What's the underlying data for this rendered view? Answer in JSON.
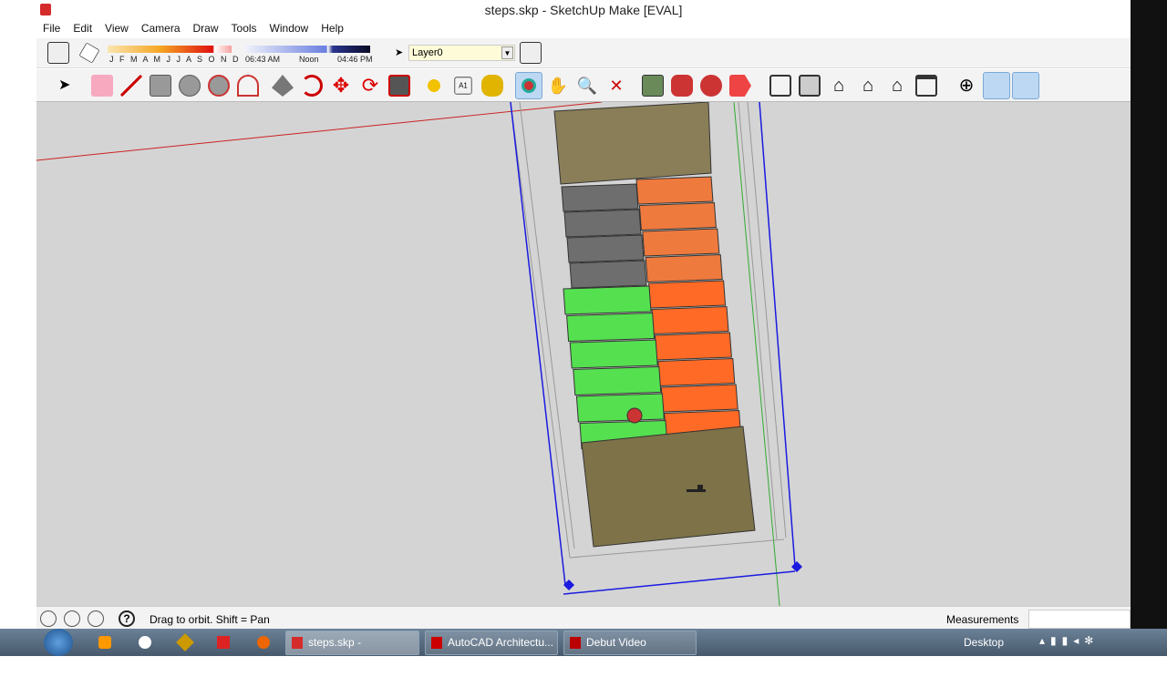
{
  "window": {
    "title": "steps.skp - SketchUp Make [EVAL]"
  },
  "menu": [
    "File",
    "Edit",
    "View",
    "Camera",
    "Draw",
    "Tools",
    "Window",
    "Help"
  ],
  "shadow": {
    "months": "J F M A M J J A S O N D",
    "time_start": "06:43 AM",
    "time_mid": "Noon",
    "time_end": "04:46 PM"
  },
  "layer": {
    "current": "Layer0"
  },
  "tools": [
    "select",
    "eraser",
    "pencil",
    "rectangle",
    "circle",
    "polygon",
    "arc",
    "push-pull",
    "follow-me",
    "move",
    "rotate",
    "scale",
    "tape-measure",
    "text",
    "paint-bucket",
    "orbit",
    "pan",
    "zoom",
    "zoom-extents",
    "section",
    "components",
    "styles",
    "get-models",
    "iso",
    "top",
    "front",
    "right",
    "back",
    "left",
    "position-camera",
    "walk",
    "look-around"
  ],
  "status": {
    "hint": "Drag to orbit.  Shift = Pan",
    "measurements_label": "Measurements",
    "measurements_value": ""
  },
  "taskbar": {
    "items": [
      "steps.skp - SketchUp...",
      "AutoCAD Architectu...",
      "Debut Video Capture..."
    ],
    "desktop": "Desktop",
    "colors": {
      "accent": "#d62b2b"
    }
  }
}
